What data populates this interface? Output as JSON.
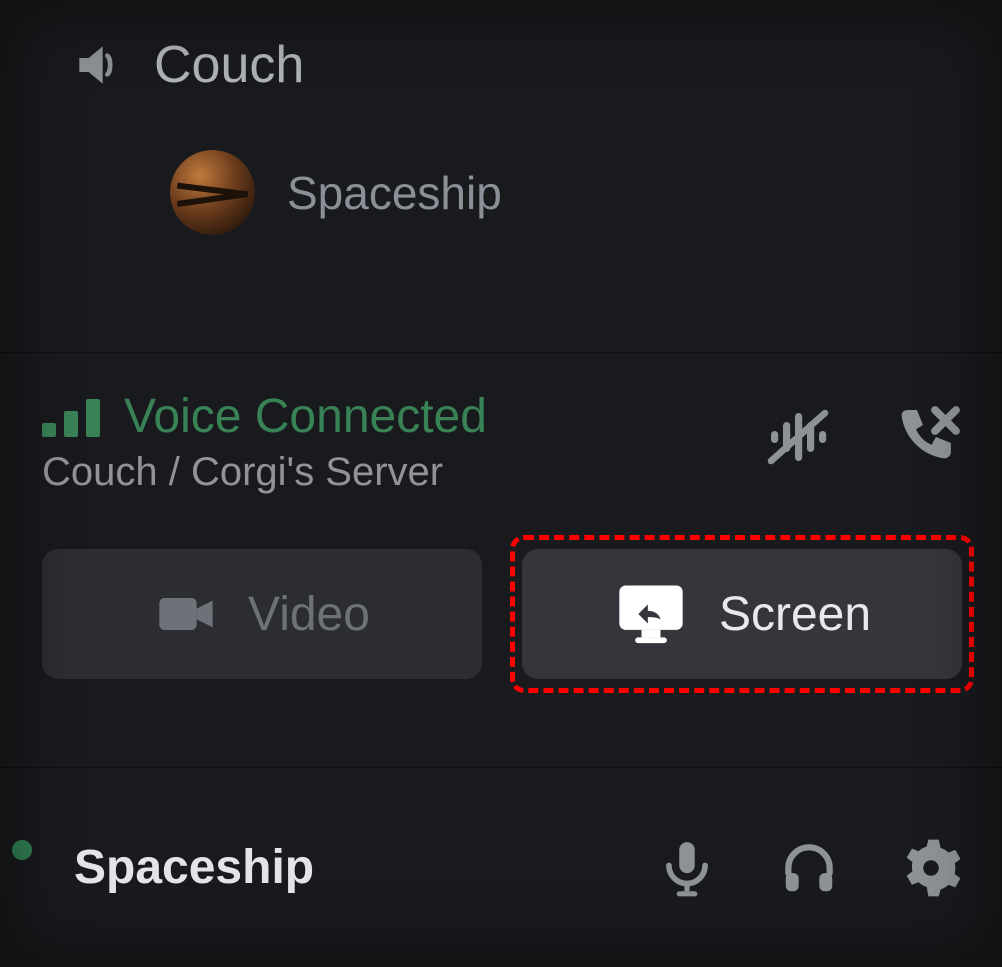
{
  "channel": {
    "name": "Couch"
  },
  "member": {
    "name": "Spaceship"
  },
  "voice": {
    "status": "Voice Connected",
    "path": "Couch / Corgi's Server"
  },
  "buttons": {
    "video": "Video",
    "screen": "Screen"
  },
  "user": {
    "name": "Spaceship"
  },
  "colors": {
    "green": "#398256",
    "highlight": "#ff0000"
  }
}
